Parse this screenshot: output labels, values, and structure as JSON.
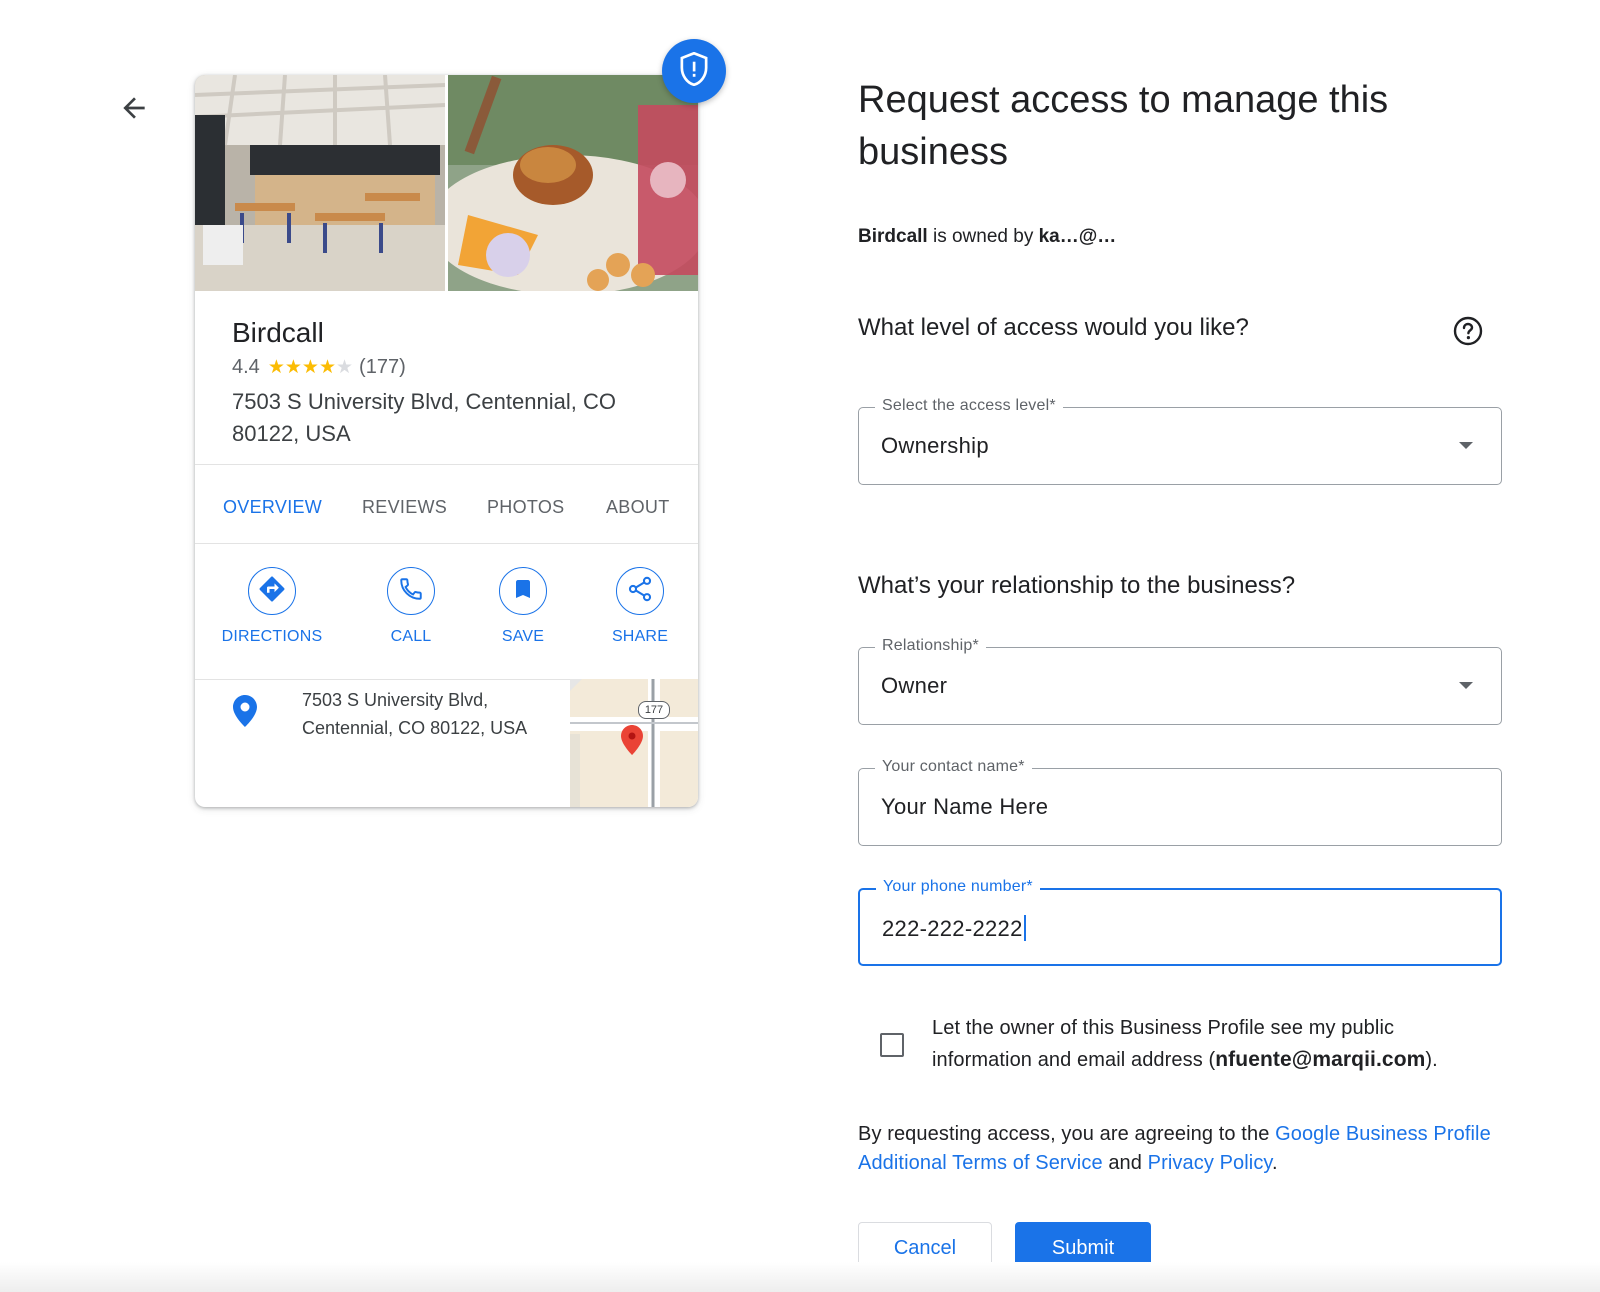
{
  "card": {
    "name": "Birdcall",
    "rating": "4.4",
    "rating_value": 4.4,
    "rating_max": 5,
    "review_count": "(177)",
    "address": "7503 S University Blvd, Centennial, CO 80122, USA",
    "tabs": [
      {
        "label": "OVERVIEW",
        "active": true
      },
      {
        "label": "REVIEWS",
        "active": false
      },
      {
        "label": "PHOTOS",
        "active": false
      },
      {
        "label": "ABOUT",
        "active": false
      }
    ],
    "actions": [
      {
        "label": "DIRECTIONS",
        "icon": "directions-icon"
      },
      {
        "label": "CALL",
        "icon": "phone-icon"
      },
      {
        "label": "SAVE",
        "icon": "bookmark-icon"
      },
      {
        "label": "SHARE",
        "icon": "share-icon"
      }
    ],
    "detail_address_line1": "7503 S University Blvd,",
    "detail_address_line2": "Centennial, CO 80122, USA",
    "map_route_label": "177"
  },
  "form": {
    "title": "Request access to manage this business",
    "owner_business": "Birdcall",
    "owner_mid": " is owned by ",
    "owner_email": "ka…@…",
    "question_access": "What level of access would you like?",
    "access_field": {
      "label": "Select the access level*",
      "value": "Ownership"
    },
    "question_relationship": "What’s your relationship to the business?",
    "relationship_field": {
      "label": "Relationship*",
      "value": "Owner"
    },
    "name_field": {
      "label": "Your contact name*",
      "value": "Your Name Here"
    },
    "phone_field": {
      "label": "Your phone number*",
      "value": "222-222-2222"
    },
    "consent_prefix": "Let the owner of this Business Profile see my public information and email address (",
    "consent_email": "nfuente@marqii.com",
    "consent_suffix": ").",
    "terms_prefix": "By requesting access, you are agreeing to the ",
    "terms_link1": "Google Business Profile Additional Terms of Service",
    "terms_mid": " and ",
    "terms_link2": "Privacy Policy",
    "terms_suffix": ".",
    "cancel_label": "Cancel",
    "submit_label": "Submit"
  },
  "colors": {
    "accent": "#1a73e8",
    "star": "#fbbc04",
    "star_empty": "#dadce0",
    "map_pin": "#ea4335"
  }
}
